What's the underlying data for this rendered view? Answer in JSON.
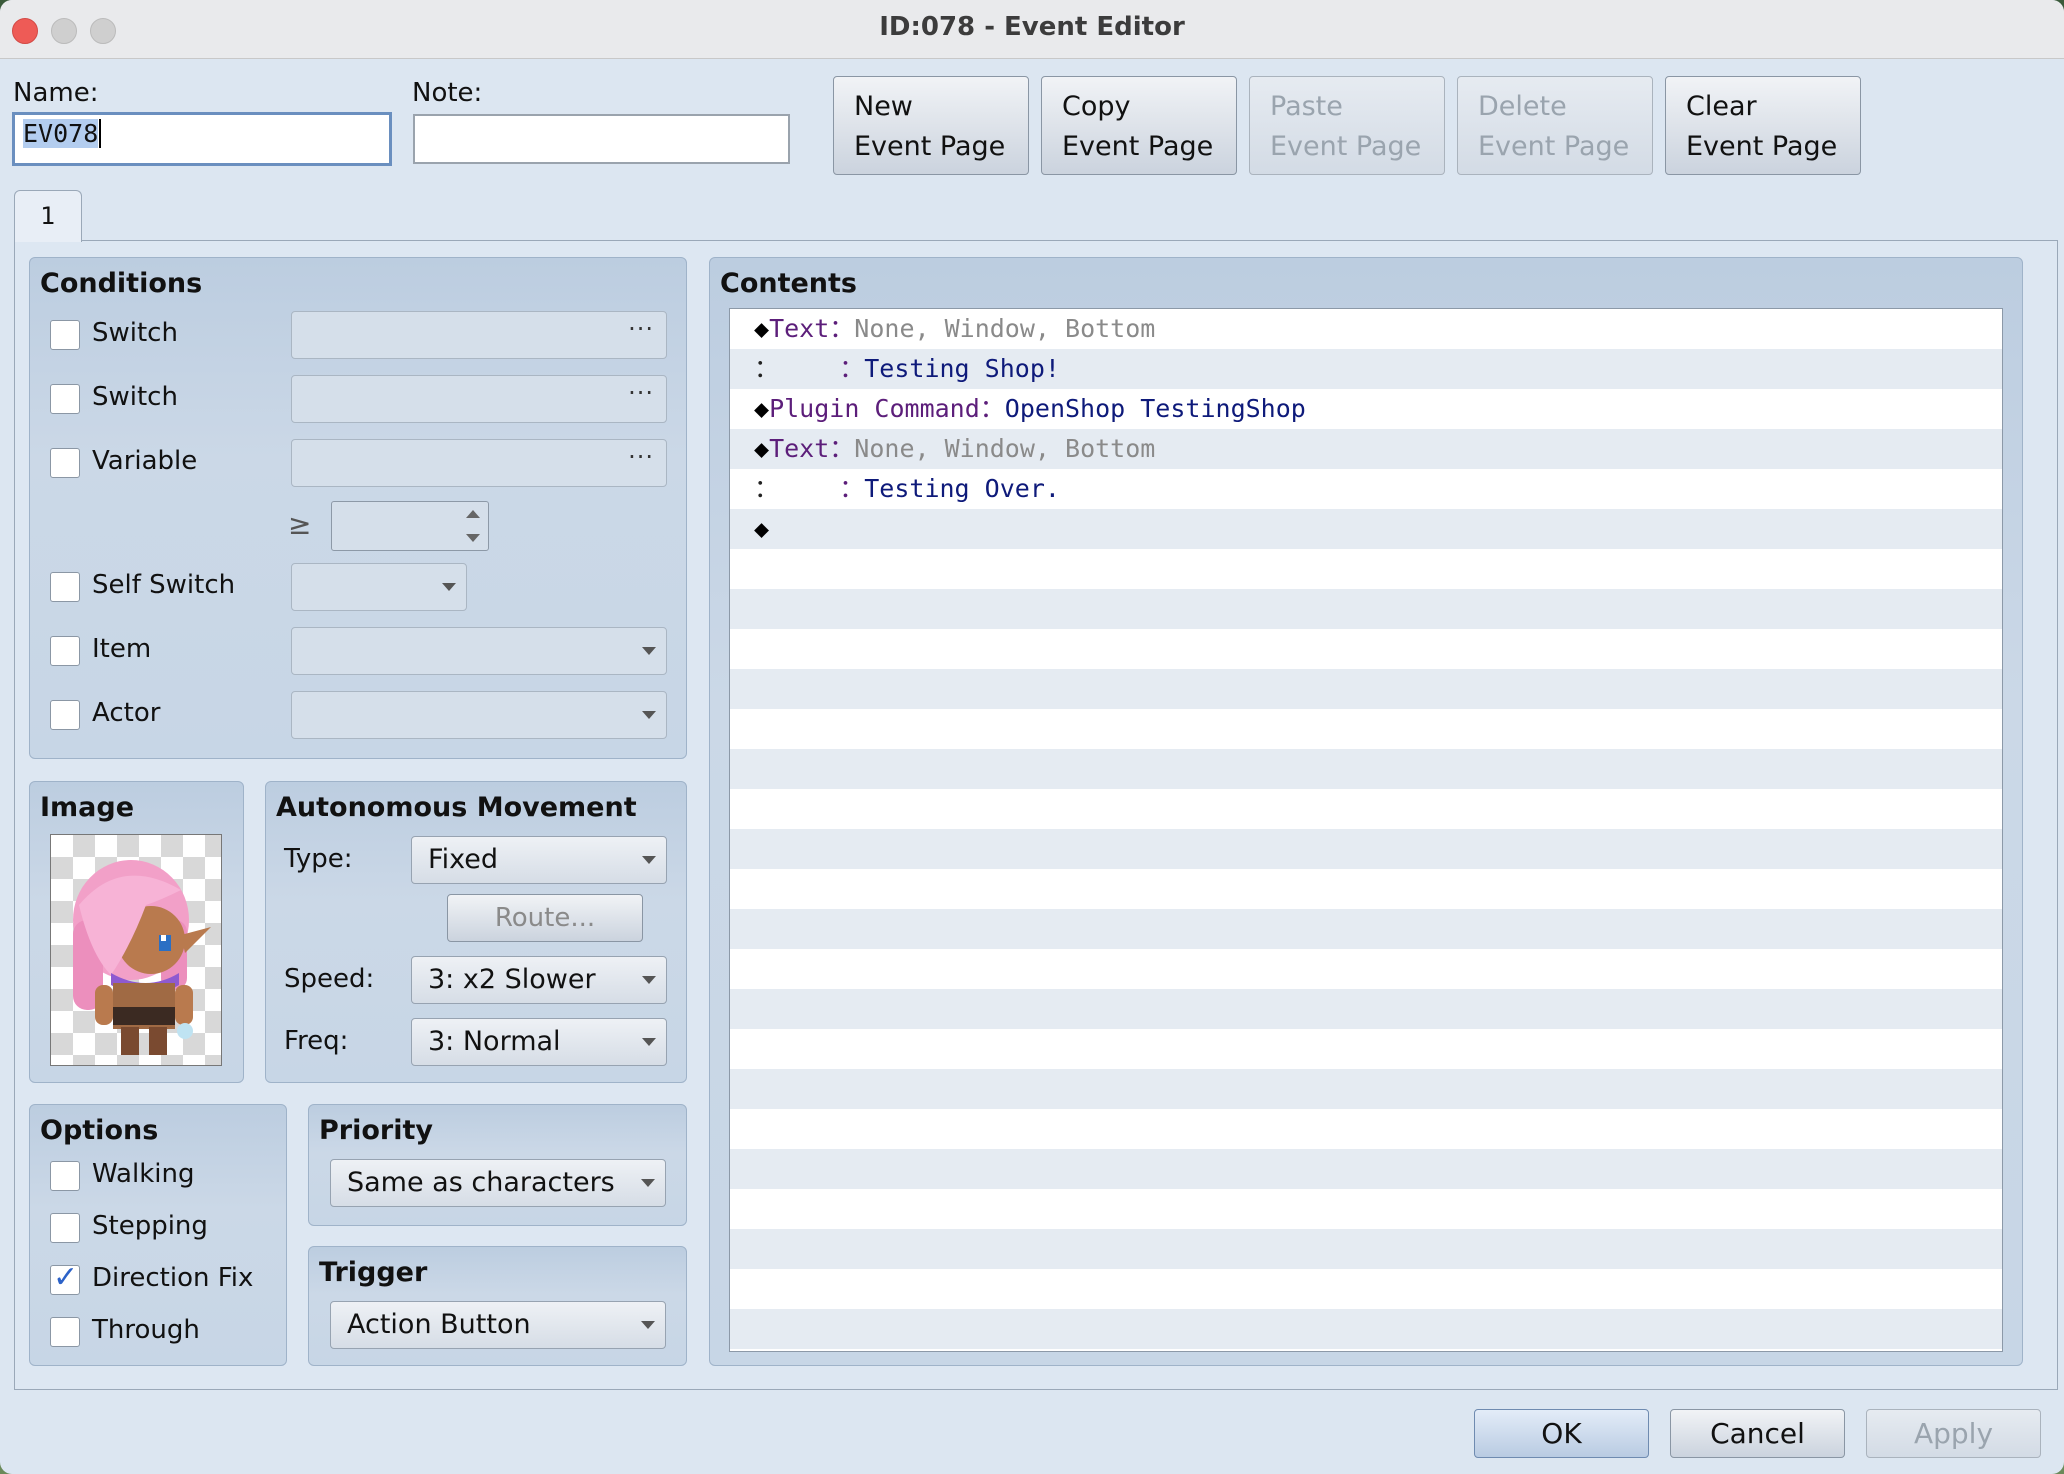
{
  "window": {
    "title": "ID:078 - Event Editor"
  },
  "header": {
    "name_label": "Name:",
    "name_value": "EV078",
    "note_label": "Note:",
    "note_value": "",
    "buttons": [
      {
        "line1": "New",
        "line2": "Event Page",
        "enabled": true
      },
      {
        "line1": "Copy",
        "line2": "Event Page",
        "enabled": true
      },
      {
        "line1": "Paste",
        "line2": "Event Page",
        "enabled": false
      },
      {
        "line1": "Delete",
        "line2": "Event Page",
        "enabled": false
      },
      {
        "line1": "Clear",
        "line2": "Event Page",
        "enabled": true
      }
    ]
  },
  "tabs": [
    {
      "label": "1"
    }
  ],
  "conditions": {
    "title": "Conditions",
    "switch1": {
      "label": "Switch",
      "checked": false
    },
    "switch2": {
      "label": "Switch",
      "checked": false
    },
    "variable": {
      "label": "Variable",
      "checked": false,
      "operator": "≥"
    },
    "self_switch": {
      "label": "Self Switch",
      "checked": false
    },
    "item": {
      "label": "Item",
      "checked": false
    },
    "actor": {
      "label": "Actor",
      "checked": false
    },
    "browse_glyph": "···"
  },
  "image": {
    "title": "Image",
    "sprite": "pink-haired-elf-character"
  },
  "movement": {
    "title": "Autonomous Movement",
    "type_label": "Type:",
    "type_value": "Fixed",
    "route_label": "Route...",
    "speed_label": "Speed:",
    "speed_value": "3: x2 Slower",
    "freq_label": "Freq:",
    "freq_value": "3: Normal"
  },
  "options": {
    "title": "Options",
    "items": [
      {
        "label": "Walking",
        "checked": false
      },
      {
        "label": "Stepping",
        "checked": false
      },
      {
        "label": "Direction Fix",
        "checked": true
      },
      {
        "label": "Through",
        "checked": false
      }
    ]
  },
  "priority": {
    "title": "Priority",
    "value": "Same as characters"
  },
  "trigger": {
    "title": "Trigger",
    "value": "Action Button"
  },
  "contents": {
    "title": "Contents",
    "lines": [
      {
        "prefix": "◆",
        "cmd": "Text",
        "sep": "：",
        "args": "None, Window, Bottom",
        "argstyle": "gray"
      },
      {
        "prefix": "：",
        "cmd": "    ",
        "sep": "：",
        "args": "Testing Shop!",
        "argstyle": "navy"
      },
      {
        "prefix": "◆",
        "cmd": "Plugin Command",
        "sep": "：",
        "args": "OpenShop TestingShop",
        "argstyle": "navy"
      },
      {
        "prefix": "◆",
        "cmd": "Text",
        "sep": "：",
        "args": "None, Window, Bottom",
        "argstyle": "gray"
      },
      {
        "prefix": "：",
        "cmd": "    ",
        "sep": "：",
        "args": "Testing Over.",
        "argstyle": "navy"
      },
      {
        "prefix": "◆",
        "cmd": "",
        "sep": "",
        "args": "",
        "argstyle": "navy"
      }
    ]
  },
  "footer": {
    "ok": "OK",
    "cancel": "Cancel",
    "apply": "Apply"
  },
  "colors": {
    "command": "#5c1e7a",
    "args_gray": "#8a8a8a",
    "args_navy": "#0e1a7a"
  }
}
